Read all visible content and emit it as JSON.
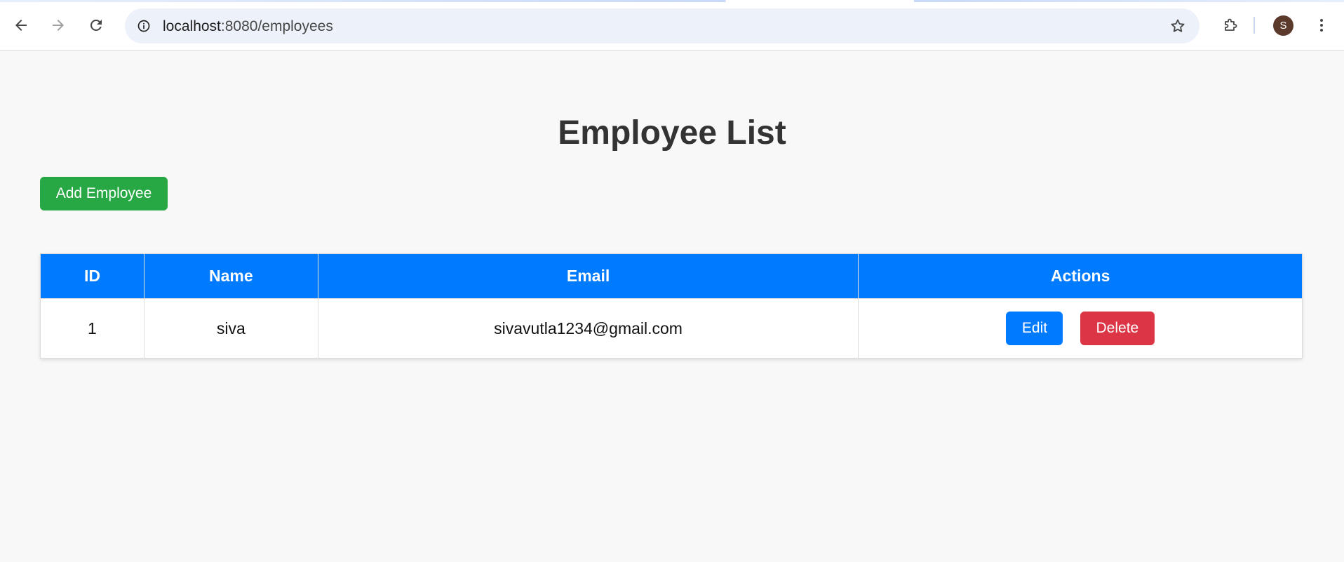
{
  "browser": {
    "url_host": "localhost",
    "url_path": ":8080/employees",
    "profile_initial": "S",
    "icons": [
      "back-arrow-icon",
      "forward-arrow-icon",
      "reload-icon",
      "site-info-icon",
      "bookmark-star-icon",
      "extensions-puzzle-icon",
      "more-vert-icon"
    ]
  },
  "page": {
    "title": "Employee List",
    "add_button_label": "Add Employee"
  },
  "table": {
    "headers": {
      "id": "ID",
      "name": "Name",
      "email": "Email",
      "actions": "Actions"
    },
    "rows": [
      {
        "id": "1",
        "name": "siva",
        "email": "sivavutla1234@gmail.com",
        "edit_label": "Edit",
        "delete_label": "Delete"
      }
    ]
  },
  "colors": {
    "header_bg": "#007bff",
    "add_button": "#28a745",
    "edit_button": "#007bff",
    "delete_button": "#dc3545",
    "page_bg": "#f8f8f8"
  }
}
